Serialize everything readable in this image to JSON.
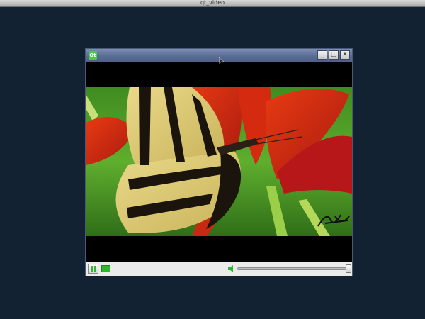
{
  "desktop": {
    "top_bar_title": "qt_video"
  },
  "window": {
    "app_icon_text": "Qt",
    "buttons": {
      "minimize_glyph": "_",
      "maximize_glyph": "□",
      "close_glyph": "✕"
    }
  },
  "video": {
    "state": "playing",
    "scene": "swallowtail butterfly on red lily"
  },
  "controls": {
    "play_pause_icon": "pause-icon",
    "stop_icon": "stop-icon",
    "volume_icon": "speaker-icon",
    "volume_level": 1.0,
    "accent_color": "#2fb52f"
  },
  "colors": {
    "desktop_background": "#132233",
    "titlebar": "#5a6d95"
  }
}
